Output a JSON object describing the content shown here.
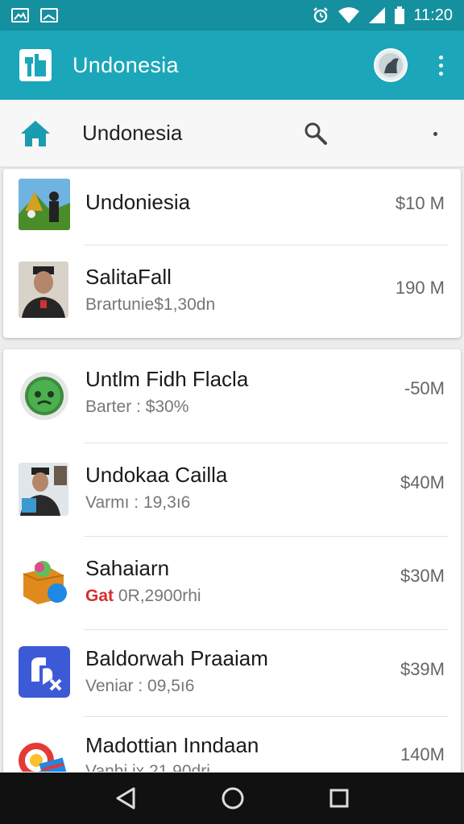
{
  "status_bar": {
    "time": "11:20"
  },
  "app_bar": {
    "title": "Undonesia"
  },
  "search_bar": {
    "query": "Undonesia"
  },
  "list_card1": [
    {
      "name": "Undoniesia",
      "subtitle": "",
      "size": "$10 M"
    },
    {
      "name": "SalitaFall",
      "subtitle": "Brartunie$1,30dn",
      "size": "190 M"
    }
  ],
  "list_card2": [
    {
      "name": "Untlm Fidh Flacla",
      "subtitle": "Barter : $30%",
      "size": "-50M"
    },
    {
      "name": "Undokaa Cailla",
      "subtitle": "Varmı : 19,3ı6",
      "size": "$40M"
    },
    {
      "name": "Sahaiarn",
      "subtitle_prefix": "Gat",
      "subtitle": " 0R,2900rhi",
      "size": "$30M"
    },
    {
      "name": "Baldorwah Praaiam",
      "subtitle": "Veniar : 09,5ı6",
      "size": "$39M"
    },
    {
      "name": "Madottian Inndaan",
      "subtitle": "Vanhi ix 21,90dri",
      "size": "140M"
    }
  ],
  "colors": {
    "status_bar": "#15909f",
    "app_bar": "#1ba6b9",
    "home_icon": "#1b9bb0",
    "nav_bar": "#111111"
  },
  "icons": [
    "gallery-icon",
    "image-icon",
    "alarm-icon",
    "wifi-icon",
    "signal-icon",
    "battery-icon",
    "app-logo-icon",
    "profile-icon",
    "overflow-menu-icon",
    "home-icon",
    "search-icon",
    "back-icon",
    "home-nav-icon",
    "recents-icon"
  ]
}
